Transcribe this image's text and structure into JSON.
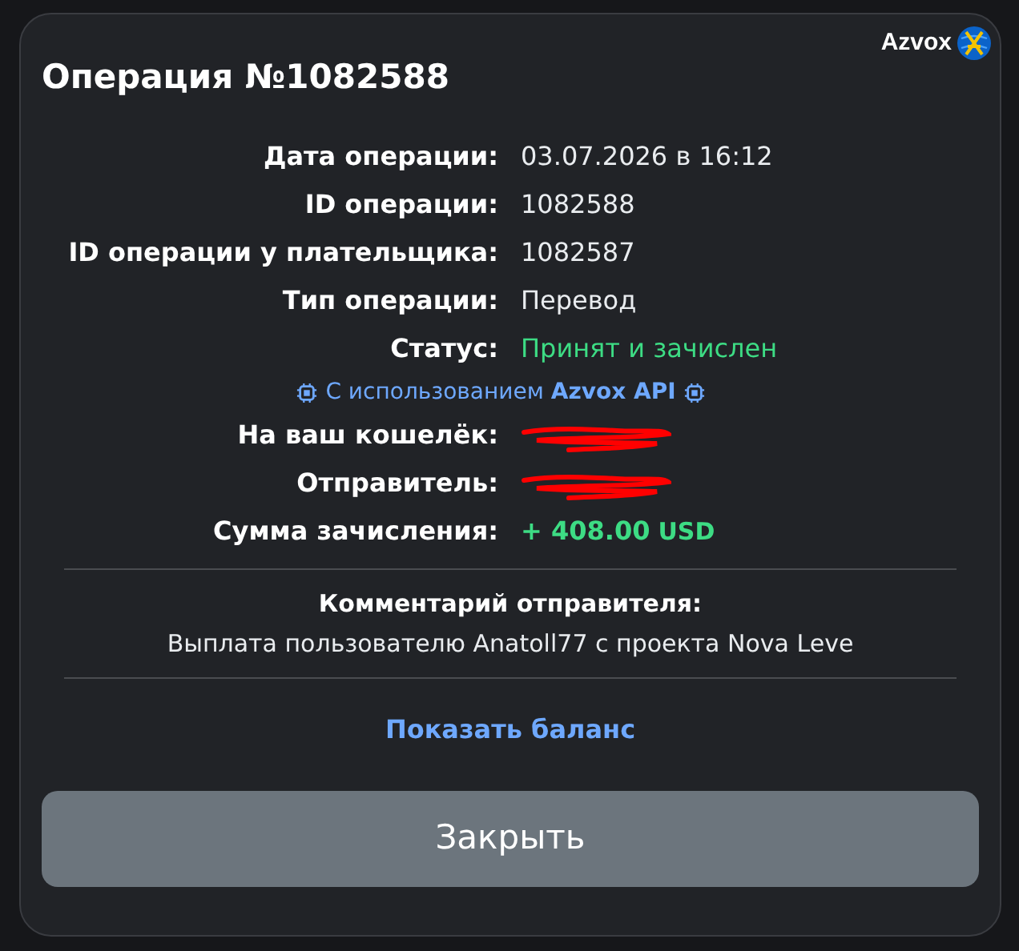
{
  "logo": {
    "text": "Azvox"
  },
  "title": "Операция №1082588",
  "details": [
    {
      "label": "Дата операции:",
      "kind": "text",
      "value": "03.07.2026 в 16:12"
    },
    {
      "label": "ID операции:",
      "kind": "text",
      "value": "1082588"
    },
    {
      "label": "ID операции у плательщика:",
      "kind": "text",
      "value": "1082587"
    },
    {
      "label": "Тип операции:",
      "kind": "text",
      "value": "Перевод"
    },
    {
      "label": "Статус:",
      "kind": "status",
      "value": "Принят и зачислен"
    }
  ],
  "api_note": "С использованием **Azvox API**",
  "details_2": [
    {
      "label": "На ваш кошелёк:",
      "kind": "redacted"
    },
    {
      "label": "Отправитель:",
      "kind": "redacted"
    },
    {
      "label": "Сумма зачисления:",
      "kind": "amount",
      "value": "+ 408.00",
      "currency": "USD"
    }
  ],
  "comment": {
    "title": "Комментарий отправителя:",
    "text": "Выплата пользователю Anatoll77 с проекта Nova Leve"
  },
  "link": "Показать баланс",
  "button": "Закрыть"
}
